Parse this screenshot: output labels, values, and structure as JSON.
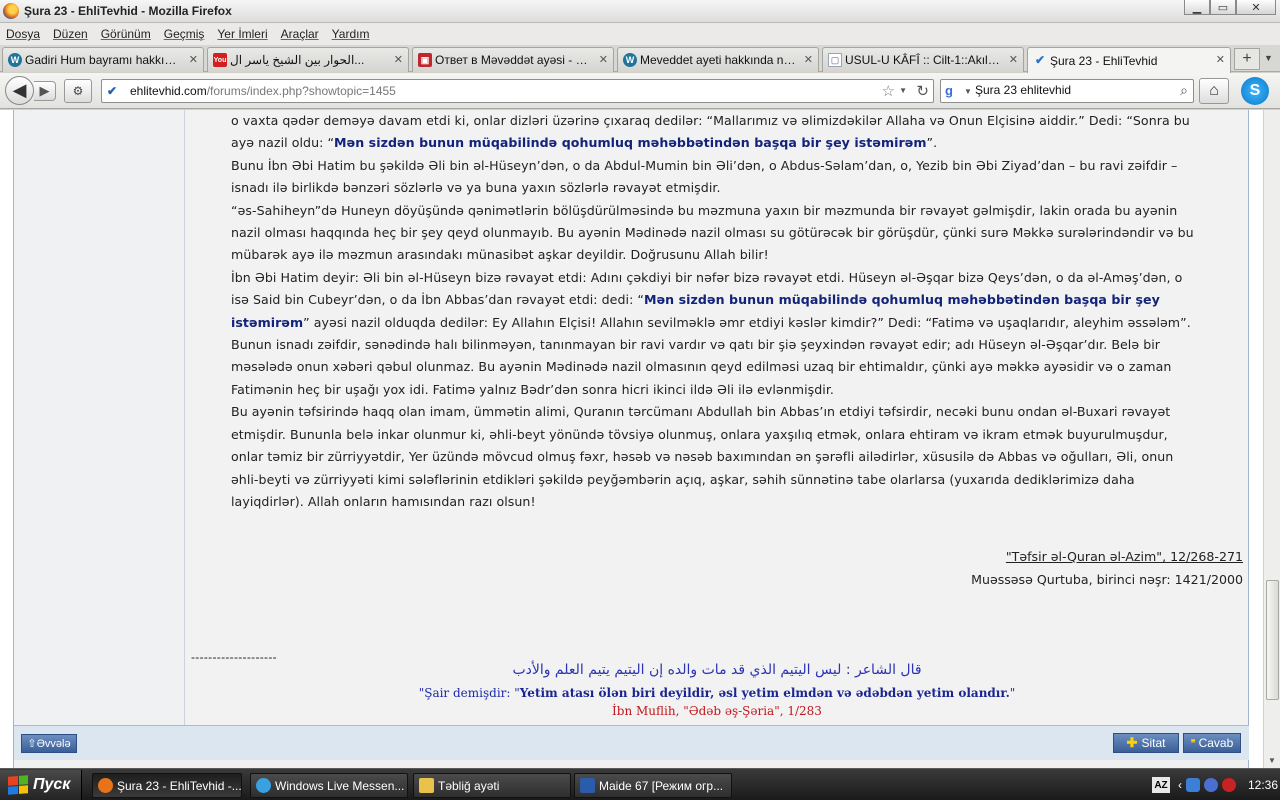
{
  "window": {
    "title": "Şura 23 - EhliTevhid - Mozilla Firefox",
    "btn_min": "▁",
    "btn_max": "▭",
    "btn_close": "✕"
  },
  "menu": [
    "Dosya",
    "Düzen",
    "Görünüm",
    "Geçmiş",
    "Yer İmleri",
    "Araçlar",
    "Yardım"
  ],
  "tabs": [
    {
      "label": "Gadiri Hum bayramı hakkında id...",
      "icon": "wordpress-icon",
      "icon_char": "W",
      "icon_color": "#21759b"
    },
    {
      "label": "الحوار بين الشيخ ياسر ال...",
      "icon": "youtube-icon",
      "icon_char": "You",
      "icon_color": "#d21f1f"
    },
    {
      "label": "Ответ в Məvəddət ayəsi - 313...",
      "icon": "forum-icon",
      "icon_char": "▣",
      "icon_color": "#c0262d"
    },
    {
      "label": "Meveddet ayeti hakkında nasibil...",
      "icon": "wordpress-icon",
      "icon_char": "W",
      "icon_color": "#21759b"
    },
    {
      "label": "USUL-U KÂFÎ :: Cilt-1::Akıl ve ...",
      "icon": "page-icon",
      "icon_char": "▢",
      "icon_color": "#9aa4b0"
    },
    {
      "label": "Şura 23 - EhliTevhid",
      "icon": "checkmark-icon",
      "icon_char": "✔",
      "icon_color": "#2d74c4"
    }
  ],
  "tab_close": "✕",
  "newtab": "+",
  "nav": {
    "back": "◀",
    "forward": "▶",
    "url_domain": "ehlitevhid.com",
    "url_path": "/forums/index.php?showtopic=1455",
    "search_value": "Şura 23 ehlitevhid",
    "home": "⌂",
    "skype": "S"
  },
  "post": {
    "paragraphs": [
      [
        {
          "t": "o vaxta qədər deməyə davam etdi ki, onlar dizləri üzərinə çıxaraq dedilər: “Mallarımız və əlimizdəkilər Allaha və Onun Elçisinə aiddir.” Dedi: “Sonra bu ayə nazil oldu: “"
        },
        {
          "t": "Mən sizdən bunun müqabilində qohumluq məhəbbətindən başqa bir şey istəmirəm",
          "q": true
        },
        {
          "t": "”."
        }
      ],
      [
        {
          "t": "Bunu İbn Əbi Hatim bu şəkildə Əli bin əl-Hüseyn’dən, o da Abdul-Mumin bin Əli’dən, o Abdus-Səlam’dan, o, Yezib bin Əbi Ziyad’dan – bu ravi zəifdir – isnadı ilə birlikdə bənzəri sözlərlə və ya buna yaxın sözlərlə rəvayət etmişdir."
        }
      ],
      [
        {
          "t": "“əs-Sahiheyn”də Huneyn döyüşündə qənimətlərin bölüşdürülməsində bu məzmuna yaxın bir məzmunda bir rəvayət gəlmişdir, lakin orada bu ayənin nazil olması haqqında heç bir şey qeyd olunmayıb. Bu ayənin Mədinədə nazil olması su götürəcək bir görüşdür, çünki surə Məkkə surələrindəndir və bu mübarək ayə ilə məzmun arasındakı münasibət aşkar deyildir. Doğrusunu Allah bilir!"
        }
      ],
      [
        {
          "t": "İbn Əbi Hatim deyir: Əli bin əl-Hüseyn bizə rəvayət etdi: Adını çəkdiyi bir nəfər bizə rəvayət etdi. Hüseyn əl-Əşqar bizə Qeys’dən, o da əl-Aməş’dən, o isə Said bin Cubeyr’dən, o da İbn Abbas’dan rəvayət etdi: dedi: “"
        },
        {
          "t": "Mən sizdən bunun müqabilində qohumluq məhəbbətindən başqa bir şey istəmirəm",
          "q": true
        },
        {
          "t": "” ayəsi nazil olduqda dedilər: Ey Allahın Elçisi! Allahın sevilməklə əmr etdiyi kəslər kimdir?” Dedi: “Fatimə və uşaqlarıdır, aleyhim əssələm”."
        }
      ],
      [
        {
          "t": "Bunun isnadı zəifdir, sənədində halı bilinməyən, tanınmayan bir ravi vardır və qatı bir şiə şeyxindən rəvayət edir; adı Hüseyn əl-Əşqar’dır. Belə bir məsələdə onun xəbəri qəbul olunmaz. Bu ayənin Mədinədə nazil olmasının qeyd edilməsi uzaq bir ehtimaldır, çünki ayə məkkə ayəsidir və o zaman Fatimənin heç bir uşağı yox idi. Fatimə yalnız Bədr’dən sonra hicri ikinci ildə Əli ilə evlənmişdir."
        }
      ],
      [
        {
          "t": "Bu ayənin təfsirində haqq olan imam, ümmətin alimi, Quranın tərcümanı Abdullah bin Abbas’ın etdiyi təfsirdir, necəki bunu ondan əl-Buxari rəvayət etmişdir. Bununla belə inkar olunmur ki, əhli-beyt yönündə tövsiyə olunmuş, onlara yaxşılıq etmək, onlara ehtiram və ikram etmək buyurulmuşdur, onlar təmiz bir zürriyyətdir, Yer üzündə mövcud olmuş fəxr, həsəb və nəsəb baxımından ən şərəfli ailədirlər, xüsusilə də Abbas və oğulları, Əli, onun əhli-beyti və zürriyyəti kimi sələflərinin etdikləri şəkildə peyğəmbərin açıq, aşkar, səhih sünnətinə tabe olarlarsa (yuxarıda dediklərimizə daha layiqdirlər). Allah onların hamısından razı olsun!"
        }
      ]
    ],
    "source_link": "\"Təfsir əl-Quran əl-Azim\", 12/268-271",
    "source_publisher": "Muəssəsə Qurtuba, birinci nəşr: 1421/2000",
    "signature": {
      "divider": "--------------------",
      "arabic": "قال الشاعر : ليس اليتيم الذي قد مات والده إن اليتيم يتيم العلم والأدب",
      "translation_prefix": "\"Şair demişdir: \"",
      "translation_bold": "Yetim atası ölən biri deyildir, əsl yetim elmdən və ədəbdən yetim olandır.",
      "translation_suffix": "\"",
      "source": "İbn Muflih, \"Ədəb əş-Şəria\", 1/283"
    }
  },
  "buttons": {
    "prev": "⇧Əvvələ",
    "quote": "Sitat",
    "reply": "Cavab"
  },
  "taskbar": {
    "start": "Пуск",
    "tasks": [
      {
        "label": "Şura 23 - EhliTevhid -...",
        "icon": "firefox-icon",
        "color": "#e8731a"
      },
      {
        "label": "Windows Live Messen...",
        "icon": "messenger-icon",
        "color": "#3aa0e0"
      },
      {
        "label": "Təbliğ ayəti",
        "icon": "folder-icon",
        "color": "#e8c24a"
      },
      {
        "label": "Maide 67 [Режим огр...",
        "icon": "word-icon",
        "color": "#2a5caa"
      }
    ],
    "lang": "AZ",
    "clock": "12:36"
  }
}
